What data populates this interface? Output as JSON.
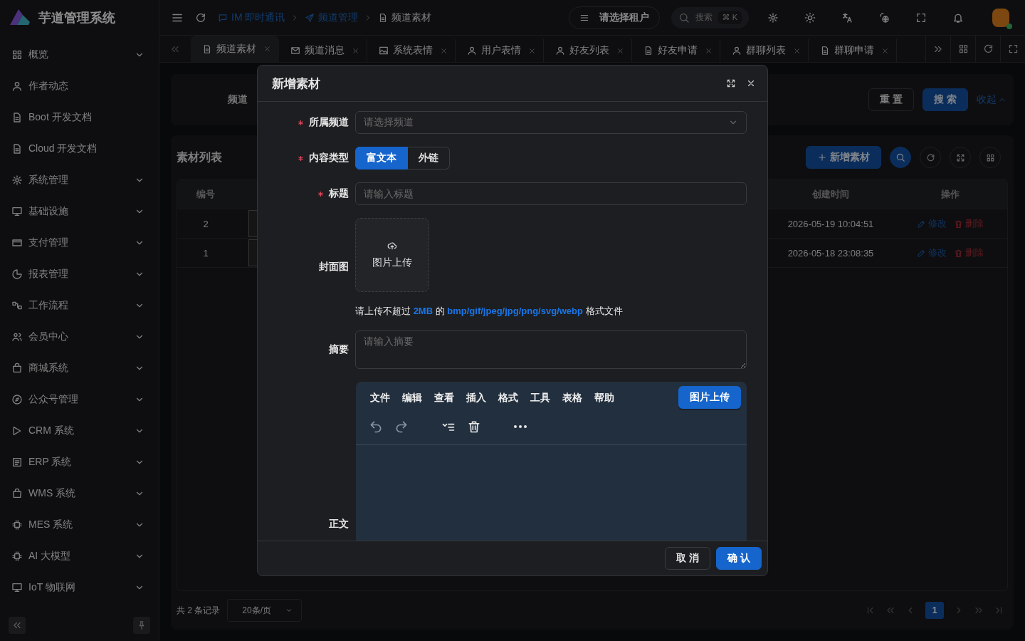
{
  "sidebar": {
    "logo": "芋道管理系统",
    "items": [
      {
        "label": "概览",
        "expandable": true
      },
      {
        "label": "作者动态",
        "expandable": false
      },
      {
        "label": "Boot 开发文档",
        "expandable": false
      },
      {
        "label": "Cloud 开发文档",
        "expandable": false
      },
      {
        "label": "系统管理",
        "expandable": true
      },
      {
        "label": "基础设施",
        "expandable": true
      },
      {
        "label": "支付管理",
        "expandable": true
      },
      {
        "label": "报表管理",
        "expandable": true
      },
      {
        "label": "工作流程",
        "expandable": true
      },
      {
        "label": "会员中心",
        "expandable": true
      },
      {
        "label": "商城系统",
        "expandable": true
      },
      {
        "label": "公众号管理",
        "expandable": true
      },
      {
        "label": "CRM 系统",
        "expandable": true
      },
      {
        "label": "ERP 系统",
        "expandable": true
      },
      {
        "label": "WMS 系统",
        "expandable": true
      },
      {
        "label": "MES 系统",
        "expandable": true
      },
      {
        "label": "AI 大模型",
        "expandable": true
      },
      {
        "label": "IoT 物联网",
        "expandable": true
      }
    ]
  },
  "header": {
    "breadcrumbs": [
      {
        "label": "IM 即时通讯",
        "current": false
      },
      {
        "label": "频道管理",
        "current": false
      },
      {
        "label": "频道素材",
        "current": true
      }
    ],
    "tenant": {
      "placeholder": "请选择租户"
    },
    "search": {
      "placeholder": "搜索",
      "shortcut": "⌘ K"
    }
  },
  "tabs": [
    {
      "label": "频道素材",
      "selected": true
    },
    {
      "label": "频道消息",
      "selected": false
    },
    {
      "label": "系统表情",
      "selected": false
    },
    {
      "label": "用户表情",
      "selected": false
    },
    {
      "label": "好友列表",
      "selected": false
    },
    {
      "label": "好友申请",
      "selected": false
    },
    {
      "label": "群聊列表",
      "selected": false
    },
    {
      "label": "群聊申请",
      "selected": false
    }
  ],
  "search_form": {
    "field_label": "频道",
    "buttons": [
      {
        "label": "重 置",
        "kind": "default"
      },
      {
        "label": "搜 索",
        "kind": "primary"
      }
    ],
    "collapse_link": "收起"
  },
  "table": {
    "title": "素材列表",
    "add_button": "新增素材",
    "columns": [
      {
        "label": "编号"
      },
      {
        "label": "创建时间"
      },
      {
        "label": "操作"
      }
    ],
    "rows": [
      {
        "id": "2",
        "created": "2026-05-19 10:04:51",
        "actions": [
          "修改",
          "删除"
        ]
      },
      {
        "id": "1",
        "created": "2026-05-18 23:08:35",
        "actions": [
          "修改",
          "删除"
        ]
      }
    ]
  },
  "pagination": {
    "total": "共 2 条记录",
    "page_size": "20条/页",
    "pages": [
      {
        "label": "1",
        "selected": true
      }
    ]
  },
  "modal": {
    "title": "新增素材",
    "fields": [
      {
        "kind": "select",
        "label": "所属频道",
        "required": true,
        "placeholder": "请选择频道"
      },
      {
        "kind": "radio",
        "label": "内容类型",
        "required": true,
        "options": [
          {
            "label": "富文本",
            "selected": true
          },
          {
            "label": "外链",
            "selected": false
          }
        ]
      },
      {
        "kind": "input",
        "label": "标题",
        "required": true,
        "placeholder": "请输入标题"
      },
      {
        "kind": "upload",
        "label": "封面图",
        "required": false,
        "button": "图片上传",
        "hint": "请上传不超过 **2MB** 的 **bmp/gif/jpeg/jpg/png/svg/webp** 格式文件"
      },
      {
        "kind": "textarea",
        "label": "摘要",
        "required": false,
        "placeholder": "请输入摘要"
      },
      {
        "kind": "editor",
        "label": "正文",
        "required": false,
        "menu": [
          "文件",
          "编辑",
          "查看",
          "插入",
          "格式",
          "工具",
          "表格",
          "帮助"
        ],
        "upload_button": "图片上传"
      }
    ],
    "buttons": [
      {
        "label": "取 消",
        "kind": "default"
      },
      {
        "label": "确 认",
        "kind": "primary"
      }
    ]
  }
}
